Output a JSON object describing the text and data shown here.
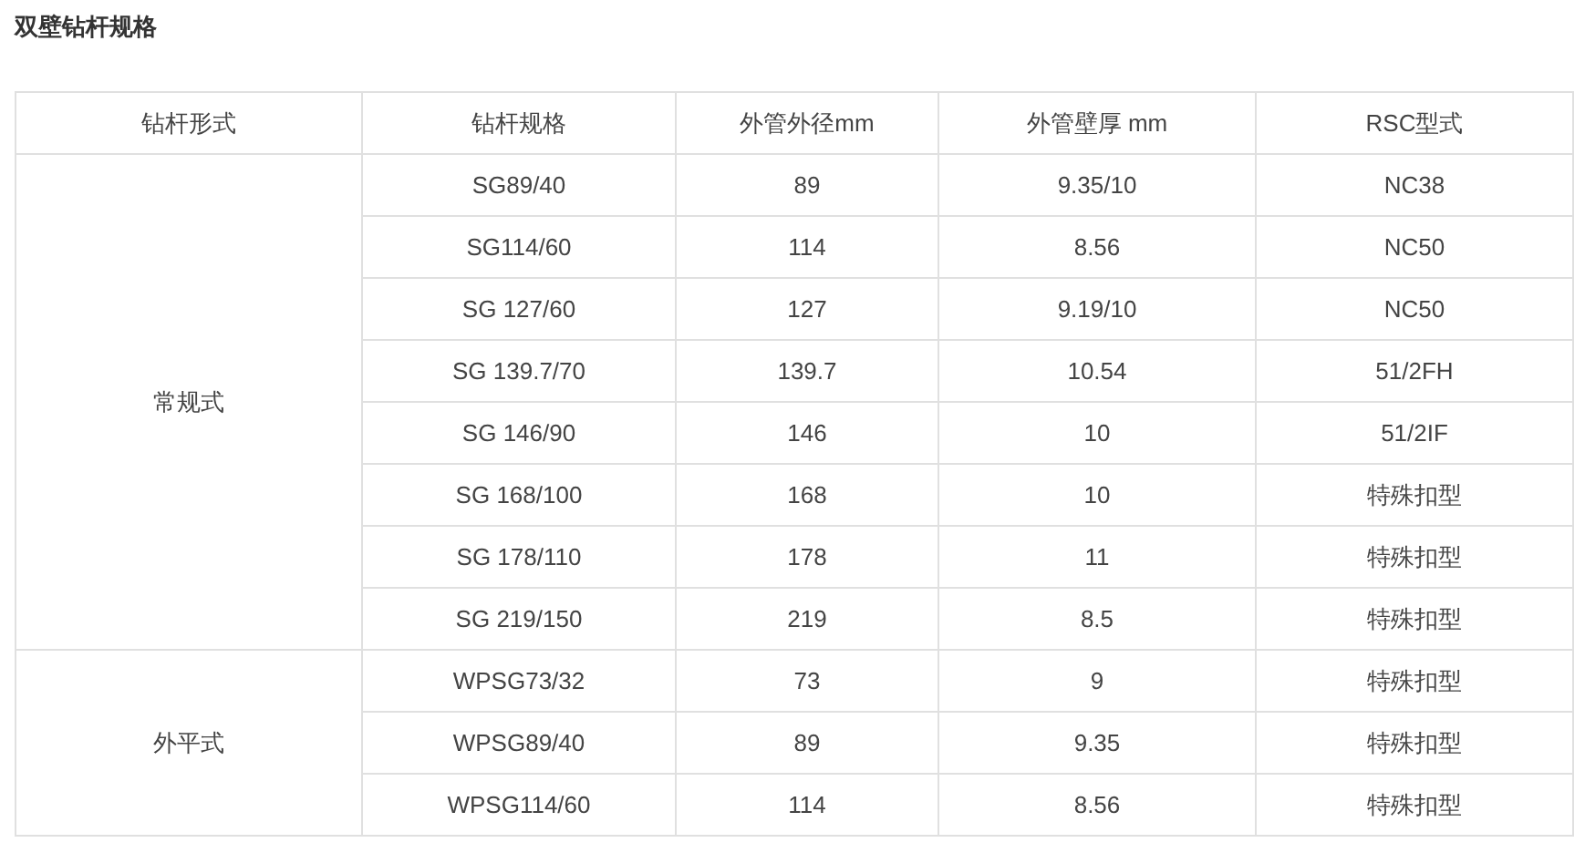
{
  "title": "双壁钻杆规格",
  "table": {
    "columns": [
      "钻杆形式",
      "钻杆规格",
      "外管外径mm",
      "外管壁厚 mm",
      "RSC型式"
    ],
    "groups": [
      {
        "label": "常规式",
        "rows": [
          [
            "SG89/40",
            "89",
            "9.35/10",
            "NC38"
          ],
          [
            "SG114/60",
            "114",
            "8.56",
            "NC50"
          ],
          [
            "SG 127/60",
            "127",
            "9.19/10",
            "NC50"
          ],
          [
            "SG 139.7/70",
            "139.7",
            "10.54",
            "51/2FH"
          ],
          [
            "SG 146/90",
            "146",
            "10",
            "51/2IF"
          ],
          [
            "SG 168/100",
            "168",
            "10",
            "特殊扣型"
          ],
          [
            "SG 178/110",
            "178",
            "11",
            "特殊扣型"
          ],
          [
            "SG 219/150",
            "219",
            "8.5",
            "特殊扣型"
          ]
        ]
      },
      {
        "label": "外平式",
        "rows": [
          [
            "WPSG73/32",
            "73",
            "9",
            "特殊扣型"
          ],
          [
            "WPSG89/40",
            "89",
            "9.35",
            "特殊扣型"
          ],
          [
            "WPSG114/60",
            "114",
            "8.56",
            "特殊扣型"
          ]
        ]
      }
    ]
  }
}
